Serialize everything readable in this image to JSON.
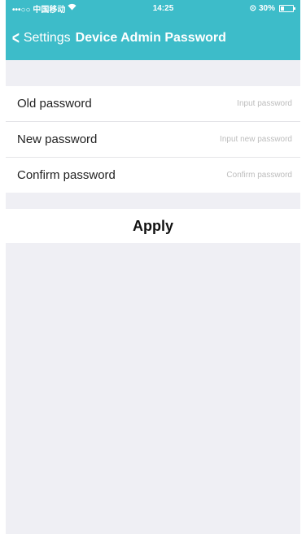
{
  "status_bar": {
    "carrier": "•••○○ 中国移动",
    "wifi_icon": "wifi-icon",
    "time": "14:25",
    "battery": "30%",
    "battery_level": 0.3
  },
  "navbar": {
    "back_label": "Settings",
    "title": "Device Admin Password"
  },
  "form": {
    "rows": [
      {
        "label": "Old password",
        "placeholder": "Input password"
      },
      {
        "label": "New password",
        "placeholder": "Input new password"
      },
      {
        "label": "Confirm password",
        "placeholder": "Confirm password"
      }
    ]
  },
  "apply_label": "Apply",
  "colors": {
    "header": "#3dbcc9",
    "background": "#efeff4"
  }
}
